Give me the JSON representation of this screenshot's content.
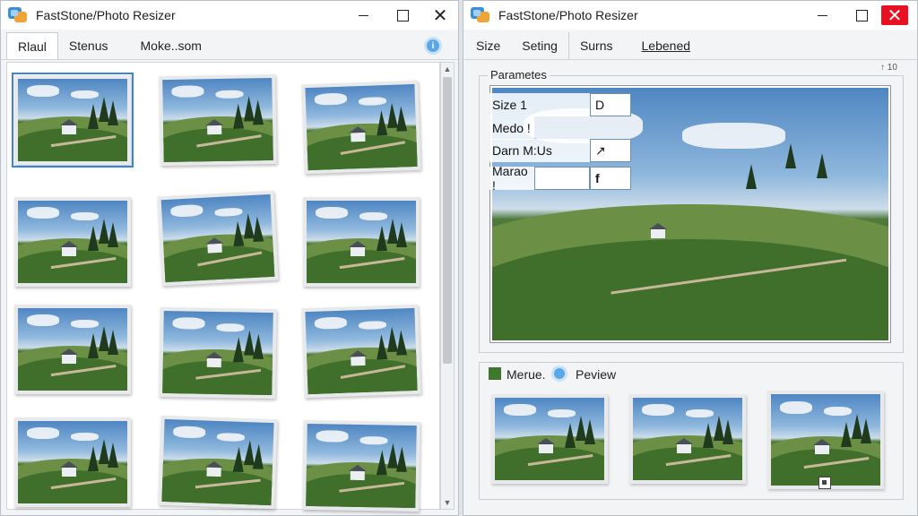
{
  "left_window": {
    "title": "FastStone/Photo Resizer",
    "tabs": [
      "Rlaul",
      "Stenus",
      "Moke..som"
    ],
    "thumbnails": 12
  },
  "right_window": {
    "title": "FastStone/Photo Resizer",
    "tabs": [
      "Size",
      "Seting",
      "Surns",
      "Lebened"
    ],
    "group_label": "Parametes",
    "corner_text": "↑ 10",
    "fields": [
      {
        "label": "Size 1",
        "value": "D"
      },
      {
        "label": "Medo !",
        "value": ""
      },
      {
        "label": "Darn M:Us",
        "value": "↗"
      },
      {
        "label": "Marao !",
        "value": "f"
      }
    ],
    "preview": {
      "merge_label": "Merue.",
      "preview_label": "Peview"
    }
  }
}
